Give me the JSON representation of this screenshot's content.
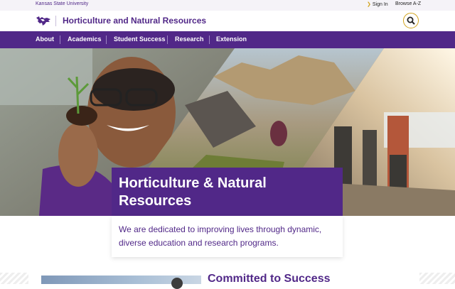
{
  "topbar": {
    "university": "Kansas State University",
    "sign_in": "Sign In",
    "browse": "Browse A-Z"
  },
  "header": {
    "department": "Horticulture and Natural Resources"
  },
  "nav": {
    "items": [
      {
        "label": "About"
      },
      {
        "label": "Academics"
      },
      {
        "label": "Student Success"
      },
      {
        "label": "Research"
      },
      {
        "label": "Extension"
      }
    ]
  },
  "hero": {
    "title": "Horticulture & Natural Resources",
    "subtitle": "We are dedicated to improving lives through dynamic, diverse education and research programs."
  },
  "promo": {
    "title": "Committed to Success"
  },
  "colors": {
    "purple": "#512888",
    "gold": "#d1a31b"
  }
}
